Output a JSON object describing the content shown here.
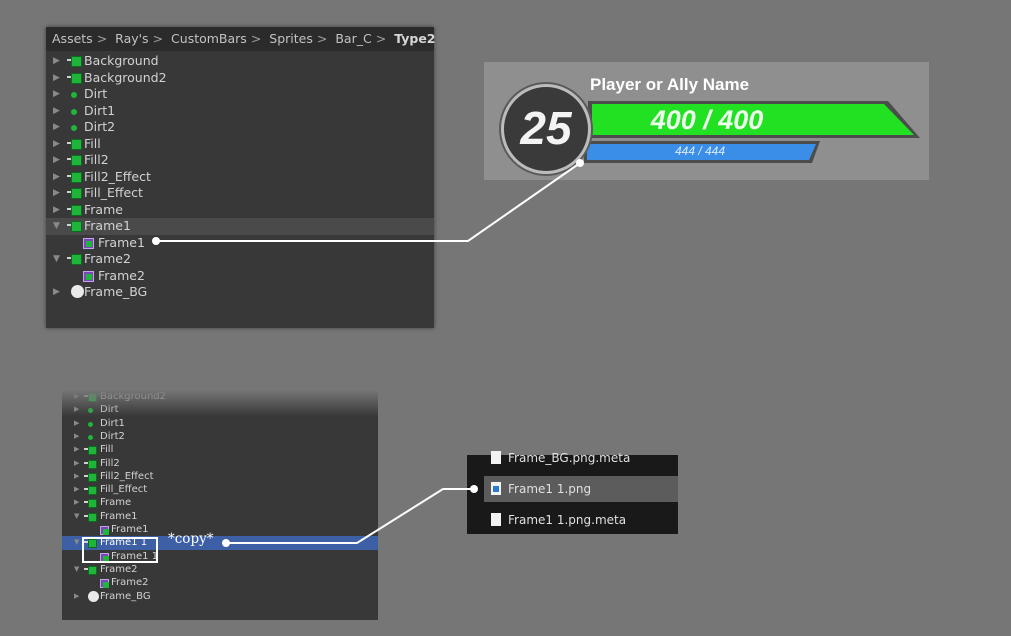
{
  "breadcrumb": {
    "items": [
      "Assets",
      "Ray's",
      "CustomBars",
      "Sprites",
      "Bar_C"
    ],
    "current": "Type2",
    "separator": ">"
  },
  "hierarchy_top": {
    "items": [
      {
        "label": "Background",
        "icon": "sprite-sheet-icon",
        "expanded": false
      },
      {
        "label": "Background2",
        "icon": "sprite-sheet-icon",
        "expanded": false
      },
      {
        "label": "Dirt",
        "icon": "circle-sprite-icon",
        "expanded": false
      },
      {
        "label": "Dirt1",
        "icon": "circle-sprite-icon",
        "expanded": false
      },
      {
        "label": "Dirt2",
        "icon": "circle-sprite-icon",
        "expanded": false
      },
      {
        "label": "Fill",
        "icon": "sprite-sheet-icon",
        "expanded": false
      },
      {
        "label": "Fill2",
        "icon": "sprite-sheet-icon",
        "expanded": false
      },
      {
        "label": "Fill2_Effect",
        "icon": "sprite-sheet-icon",
        "expanded": false
      },
      {
        "label": "Fill_Effect",
        "icon": "sprite-sheet-icon",
        "expanded": false
      },
      {
        "label": "Frame",
        "icon": "sprite-sheet-icon",
        "expanded": false
      },
      {
        "label": "Frame1",
        "icon": "sprite-sheet-icon",
        "expanded": true,
        "selected": true
      },
      {
        "label": "Frame1",
        "icon": "texture-icon",
        "child": true
      },
      {
        "label": "Frame2",
        "icon": "sprite-sheet-icon",
        "expanded": true
      },
      {
        "label": "Frame2",
        "icon": "texture-icon",
        "child": true
      },
      {
        "label": "Frame_BG",
        "icon": "white-circle-icon",
        "expanded": false
      }
    ]
  },
  "health_bar": {
    "name": "Player or Ally Name",
    "level": "25",
    "hp_text": "400 / 400",
    "mp_text": "444 / 444",
    "hp_fraction": 1.0,
    "mp_fraction": 1.0,
    "colors": {
      "hp": "#22e022",
      "mp": "#3a8ee8",
      "frame": "#bcbcbc",
      "bg": "#8f8f8f"
    }
  },
  "hierarchy_bottom": {
    "items": [
      {
        "label": "Background2",
        "icon": "sprite-sheet-icon"
      },
      {
        "label": "Dirt",
        "icon": "circle-sprite-icon"
      },
      {
        "label": "Dirt1",
        "icon": "circle-sprite-icon"
      },
      {
        "label": "Dirt2",
        "icon": "circle-sprite-icon"
      },
      {
        "label": "Fill",
        "icon": "sprite-sheet-icon"
      },
      {
        "label": "Fill2",
        "icon": "sprite-sheet-icon"
      },
      {
        "label": "Fill2_Effect",
        "icon": "sprite-sheet-icon"
      },
      {
        "label": "Fill_Effect",
        "icon": "sprite-sheet-icon"
      },
      {
        "label": "Frame",
        "icon": "sprite-sheet-icon"
      },
      {
        "label": "Frame1",
        "icon": "sprite-sheet-icon",
        "expanded": true
      },
      {
        "label": "Frame1",
        "icon": "texture-icon",
        "child": true
      },
      {
        "label": "Frame1 1",
        "icon": "sprite-sheet-icon",
        "expanded": true,
        "selected": true
      },
      {
        "label": "Frame1 1",
        "icon": "texture-icon",
        "child": true
      },
      {
        "label": "Frame2",
        "icon": "sprite-sheet-icon",
        "expanded": true
      },
      {
        "label": "Frame2",
        "icon": "texture-icon",
        "child": true
      },
      {
        "label": "Frame_BG",
        "icon": "white-circle-icon"
      }
    ]
  },
  "annotation": {
    "copy_label": "*copy*"
  },
  "files": {
    "items": [
      {
        "label": "Frame_BG.png.meta",
        "icon": "document-icon"
      },
      {
        "label": "Frame1 1.png",
        "icon": "png-file-icon",
        "selected": true
      },
      {
        "label": "Frame1 1.png.meta",
        "icon": "document-icon"
      }
    ]
  }
}
